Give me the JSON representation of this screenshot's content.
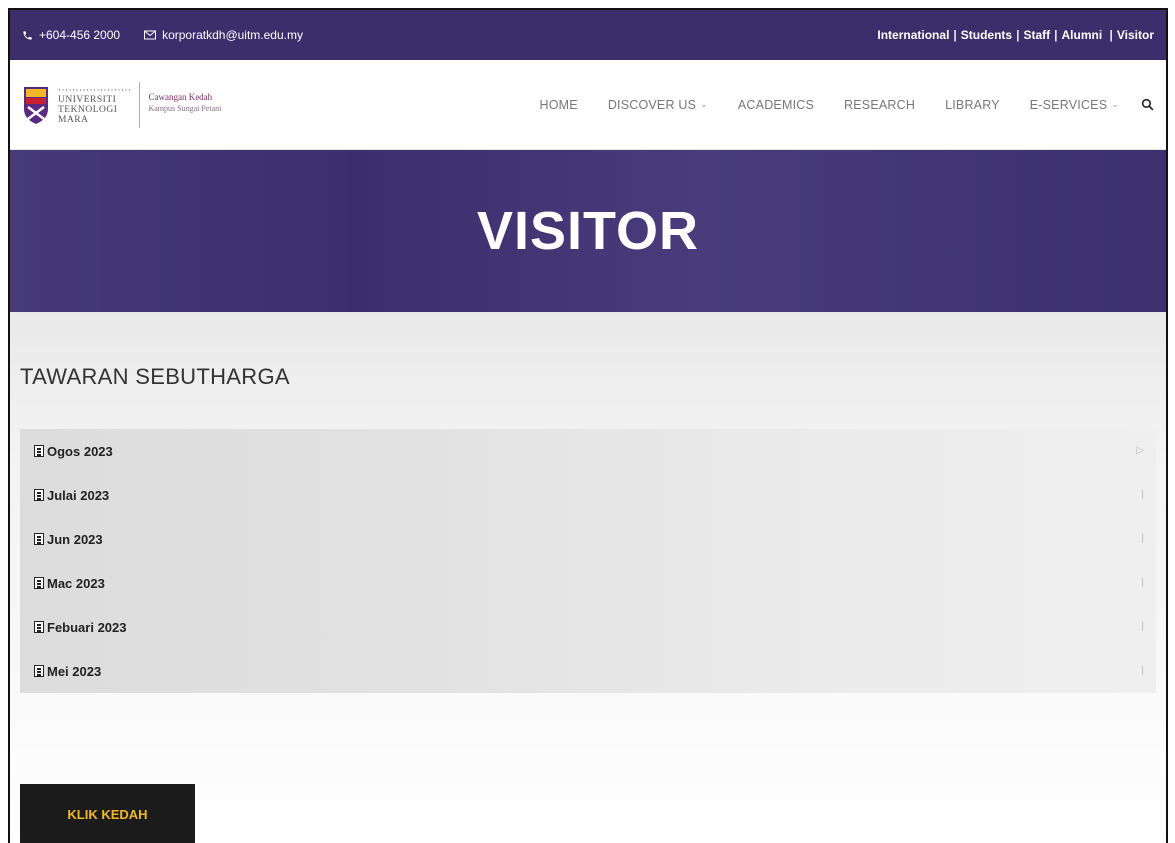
{
  "topbar": {
    "phone": "+604-456 2000",
    "email": "korporatkdh@uitm.edu.my",
    "links": [
      "International",
      "Students",
      "Staff",
      "Alumni",
      "Visitor"
    ]
  },
  "logo": {
    "line1": "UNIVERSITI",
    "line2": "TEKNOLOGI",
    "line3": "MARA",
    "campus": "Cawangan Kedah",
    "campus_sub": "Kampus Sungai Petani"
  },
  "nav": {
    "items": [
      "HOME",
      "DISCOVER US",
      "ACADEMICS",
      "RESEARCH",
      "LIBRARY",
      "E-SERVICES"
    ]
  },
  "banner": {
    "title": "VISITOR"
  },
  "section": {
    "title": "TAWARAN SEBUTHARGA",
    "rows": [
      "Ogos 2023",
      "Julai 2023",
      "Jun 2023",
      "Mac 2023",
      "Febuari 2023",
      "Mei 2023"
    ]
  },
  "klik_button": {
    "label": "KLIK KEDAH"
  },
  "colors": {
    "brand_purple": "#3b2f6b",
    "button_bg": "#1b1b1b",
    "button_text": "#f2b827"
  }
}
